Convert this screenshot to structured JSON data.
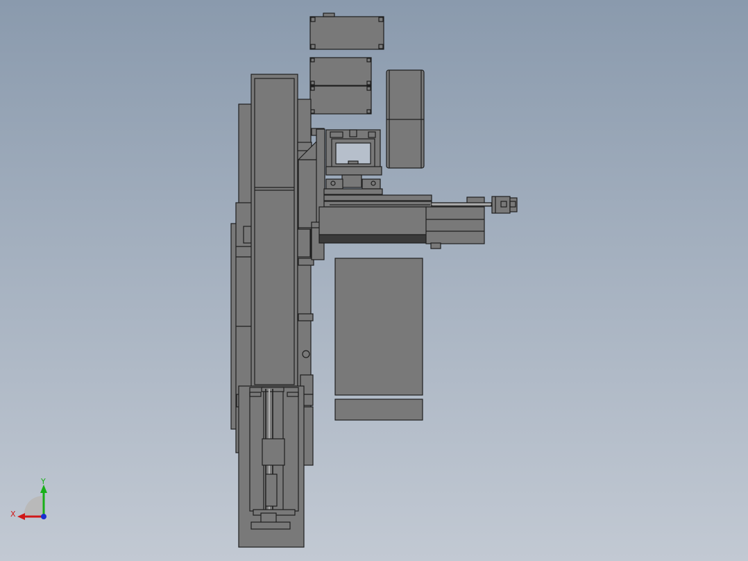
{
  "colors": {
    "part_fill": "#797979",
    "part_fill_light": "#808080",
    "part_dark": "#3a3a3a",
    "edge": "#1e1e1e",
    "x_axis": "#d01818",
    "y_axis": "#18b018",
    "z_axis": "#1a2fd0"
  },
  "triad": {
    "x_label": "X",
    "y_label": "Y"
  }
}
